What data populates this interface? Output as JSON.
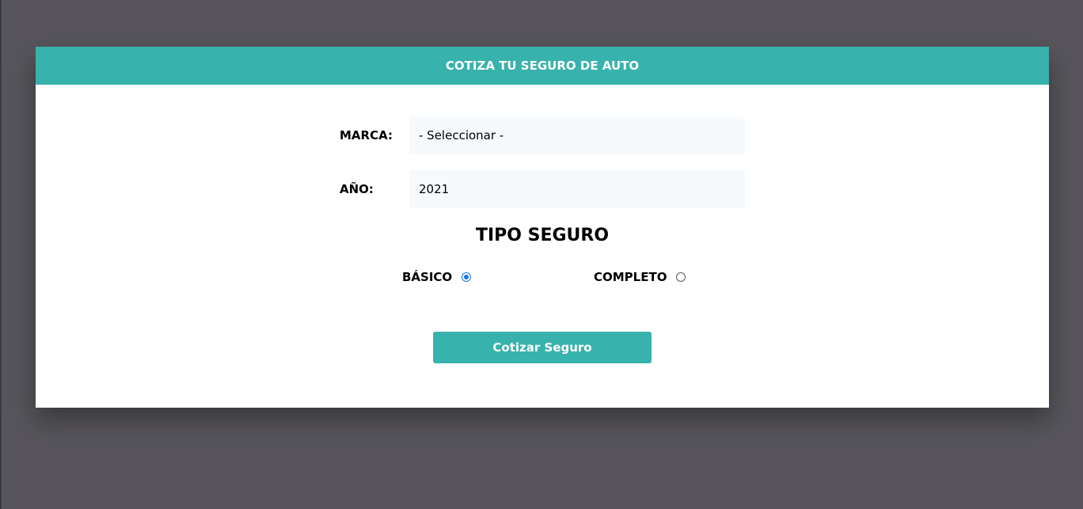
{
  "header": {
    "title": "COTIZA TU SEGURO DE AUTO"
  },
  "form": {
    "marca": {
      "label": "MARCA:",
      "selected": "- Seleccionar -"
    },
    "anio": {
      "label": "AÑO:",
      "selected": "2021"
    },
    "tipo_seguro": {
      "title": "TIPO SEGURO",
      "options": [
        {
          "label": "BÁSICO",
          "checked": true
        },
        {
          "label": "COMPLETO",
          "checked": false
        }
      ]
    },
    "submit_label": "Cotizar Seguro"
  },
  "colors": {
    "accent": "#38b2ac",
    "background": "#57555b",
    "field_bg": "#f7fafc"
  }
}
